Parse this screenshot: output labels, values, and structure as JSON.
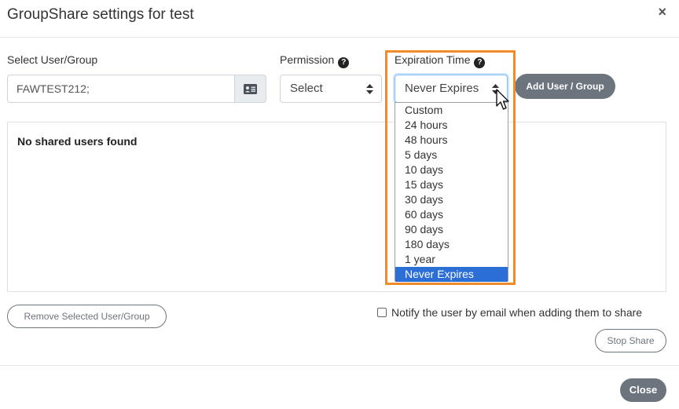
{
  "modal": {
    "title": "GroupShare settings for test",
    "close_symbol": "×"
  },
  "form": {
    "user_label": "Select User/Group",
    "user_value": "FAWTEST212;",
    "permission_label": "Permission",
    "permission_value": "Select",
    "expiration_label": "Expiration Time",
    "expiration_value": "Never Expires",
    "add_button": "Add User / Group",
    "help_symbol": "?"
  },
  "expiration_options": [
    "Custom",
    "24 hours",
    "48 hours",
    "5 days",
    "10 days",
    "15 days",
    "30 days",
    "60 days",
    "90 days",
    "180 days",
    "1 year",
    "Never Expires"
  ],
  "selected_option": "Never Expires",
  "table": {
    "empty_text": "No shared users found"
  },
  "actions": {
    "remove_button": "Remove Selected User/Group",
    "notify_label": "Notify the user by email when adding them to share",
    "stop_share_button": "Stop Share",
    "close_button": "Close"
  },
  "colors": {
    "highlight_border": "#f28c28",
    "selected_option_bg": "#2b6fd6",
    "button_gray": "#6c757d"
  }
}
